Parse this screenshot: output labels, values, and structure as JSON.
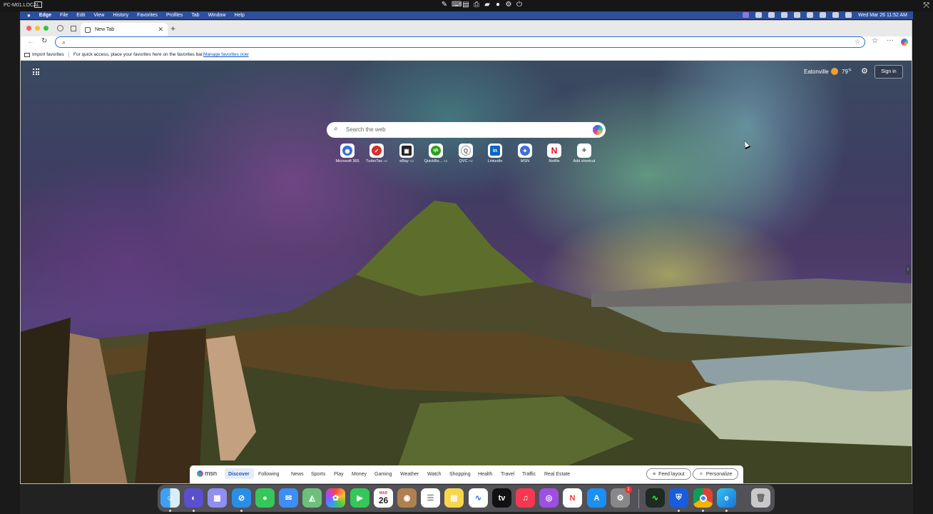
{
  "remote": {
    "host": "PC-M01.LOCAL"
  },
  "menubar": {
    "app": "Edge",
    "items": [
      "File",
      "Edit",
      "View",
      "History",
      "Favorites",
      "Profiles",
      "Tab",
      "Window",
      "Help"
    ],
    "clock": "Wed Mar 26  11:52 AM"
  },
  "browser": {
    "tab_title": "New Tab",
    "address_value": "",
    "favbar": {
      "import": "Import favorites",
      "message": "For quick access, place your favorites here on the favorites bar.",
      "link": "Manage favorites now"
    }
  },
  "ntp": {
    "location": "Eatonville",
    "temperature": "79",
    "temp_unit": "°F",
    "sign_in": "Sign in",
    "search_placeholder": "Search the web",
    "shortcuts": [
      {
        "label": "Microsoft 365",
        "ad": "",
        "color": "#3a6fd8",
        "glyph": "◉"
      },
      {
        "label": "TurboTax",
        "ad": "Ad",
        "color": "#d62d2d",
        "glyph": "✓"
      },
      {
        "label": "eBay",
        "ad": "Ad",
        "color": "#222222",
        "glyph": "▣"
      },
      {
        "label": "QuickBo...",
        "ad": "Ad",
        "color": "#2ca01c",
        "glyph": "qb"
      },
      {
        "label": "QVC",
        "ad": "Ad",
        "color": "#c9c9c9",
        "glyph": "Q"
      },
      {
        "label": "LinkedIn",
        "ad": "",
        "color": "#0a66c2",
        "glyph": "in"
      },
      {
        "label": "MSN",
        "ad": "",
        "color": "#3b6fd4",
        "glyph": "✦"
      },
      {
        "label": "Netflix",
        "ad": "",
        "color": "#ffffff",
        "glyph": "N"
      },
      {
        "label": "Add shortcut",
        "ad": "",
        "color": "#ffffff",
        "glyph": "+"
      }
    ]
  },
  "feed": {
    "brand": "msn",
    "categories": [
      "Discover",
      "Following",
      "News",
      "Sports",
      "Play",
      "Money",
      "Gaming",
      "Weather",
      "Watch",
      "Shopping",
      "Health",
      "Travel",
      "Traffic",
      "Real Estate"
    ],
    "active": "Discover",
    "feed_layout": "Feed layout",
    "personalize": "Personalize"
  },
  "dock": {
    "calendar_month": "MAR",
    "calendar_day": "26",
    "settings_badge": "1",
    "apps": [
      "finder-icon",
      "launchpad-icon",
      "apps-grid-icon",
      "safari-icon",
      "messages-icon",
      "mail-icon",
      "maps-icon",
      "photos-icon",
      "facetime-icon",
      "calendar-icon",
      "contacts-icon",
      "reminders-icon",
      "notes-icon",
      "freeform-icon",
      "appletv-icon",
      "music-icon",
      "podcasts-icon",
      "news-icon",
      "appstore-icon",
      "settings-icon",
      "activity-monitor-icon",
      "bitwarden-icon",
      "chrome-icon",
      "edge-icon",
      "trash-icon"
    ]
  }
}
